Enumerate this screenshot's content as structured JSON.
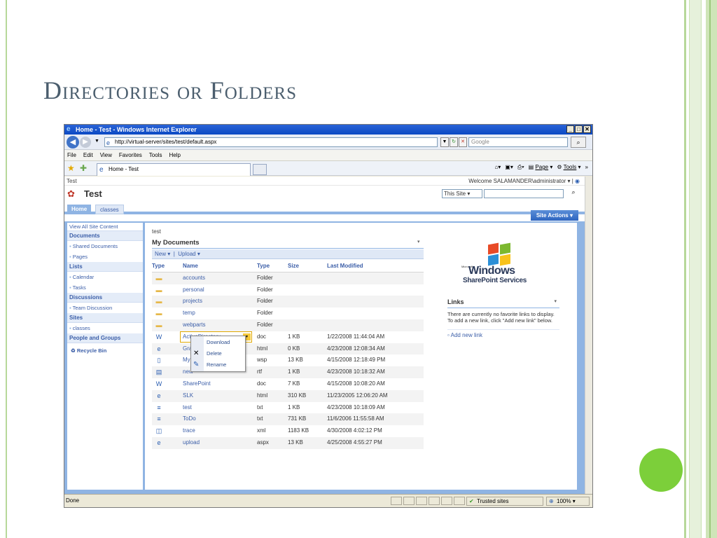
{
  "slide": {
    "title": "Directories or Folders"
  },
  "window": {
    "title": "Home - Test - Windows Internet Explorer",
    "address": "http://virtual-server/sites/test/default.aspx",
    "search_placeholder": "Google",
    "menu": [
      "File",
      "Edit",
      "View",
      "Favorites",
      "Tools",
      "Help"
    ],
    "tab_label": "Home - Test",
    "command_page": "Page",
    "command_tools": "Tools"
  },
  "sharepoint": {
    "site_label": "Test",
    "welcome": "Welcome SALAMANDER\\administrator",
    "site_title": "Test",
    "scope_select": "This Site",
    "nav_home": "Home",
    "nav_classes": "classes",
    "site_actions": "Site Actions",
    "quick_launch": {
      "view_all": "View All Site Content",
      "sections": [
        {
          "heading": "Documents",
          "items": [
            "Shared Documents",
            "Pages"
          ]
        },
        {
          "heading": "Lists",
          "items": [
            "Calendar",
            "Tasks"
          ]
        },
        {
          "heading": "Discussions",
          "items": [
            "Team Discussion"
          ]
        },
        {
          "heading": "Sites",
          "items": [
            "classes"
          ]
        },
        {
          "heading": "People and Groups",
          "items": []
        }
      ],
      "recycle_bin": "Recycle Bin"
    },
    "breadcrumb": "test",
    "list_title": "My Documents",
    "toolbar": {
      "new": "New",
      "upload": "Upload"
    },
    "columns": [
      "Type",
      "Name",
      "Type",
      "Size",
      "Last Modified"
    ],
    "rows": [
      {
        "icon": "folder-icon",
        "name": "accounts",
        "type": "Folder",
        "size": "",
        "modified": ""
      },
      {
        "icon": "folder-icon",
        "name": "personal",
        "type": "Folder",
        "size": "",
        "modified": ""
      },
      {
        "icon": "folder-icon",
        "name": "projects",
        "type": "Folder",
        "size": "",
        "modified": ""
      },
      {
        "icon": "folder-icon",
        "name": "temp",
        "type": "Folder",
        "size": "",
        "modified": ""
      },
      {
        "icon": "folder-icon",
        "name": "webparts",
        "type": "Folder",
        "size": "",
        "modified": ""
      },
      {
        "icon": "word-doc-icon",
        "name": "ActiveDirectory",
        "type": "doc",
        "size": "1 KB",
        "modified": "1/22/2008 11:44:04 AM"
      },
      {
        "icon": "html-icon",
        "name": "Grad",
        "type": "html",
        "size": "0 KB",
        "modified": "4/23/2008 12:08:34 AM"
      },
      {
        "icon": "file-icon",
        "name": "MyDi",
        "type": "wsp",
        "size": "13 KB",
        "modified": "4/15/2008 12:18:49 PM"
      },
      {
        "icon": "rtf-icon",
        "name": "new",
        "type": "rtf",
        "size": "1 KB",
        "modified": "4/23/2008 10:18:32 AM"
      },
      {
        "icon": "word-doc-icon",
        "name": "SharePoint",
        "type": "doc",
        "size": "7 KB",
        "modified": "4/15/2008 10:08:20 AM"
      },
      {
        "icon": "html-icon",
        "name": "SLK",
        "type": "html",
        "size": "310 KB",
        "modified": "11/23/2005 12:06:20 AM"
      },
      {
        "icon": "text-icon",
        "name": "test",
        "type": "txt",
        "size": "1 KB",
        "modified": "4/23/2008 10:18:09 AM"
      },
      {
        "icon": "text-icon",
        "name": "ToDo",
        "type": "txt",
        "size": "731 KB",
        "modified": "11/6/2006 11:55:58 AM"
      },
      {
        "icon": "xml-icon",
        "name": "trace",
        "type": "xml",
        "size": "1183 KB",
        "modified": "4/30/2008 4:02:12 PM"
      },
      {
        "icon": "html-icon",
        "name": "upload",
        "type": "aspx",
        "size": "13 KB",
        "modified": "4/25/2008 4:55:27 PM"
      }
    ],
    "context_menu": [
      "Download",
      "Delete",
      "Rename"
    ],
    "logo": {
      "microsoft": "Microsoft",
      "windows": "Windows",
      "product": "SharePoint Services"
    },
    "links": {
      "title": "Links",
      "empty_text": "There are currently no favorite links to display. To add a new link, click \"Add new link\" below.",
      "add_new": "Add new link"
    }
  },
  "status": {
    "left": "Done",
    "zone": "Trusted sites",
    "zoom": "100%"
  }
}
